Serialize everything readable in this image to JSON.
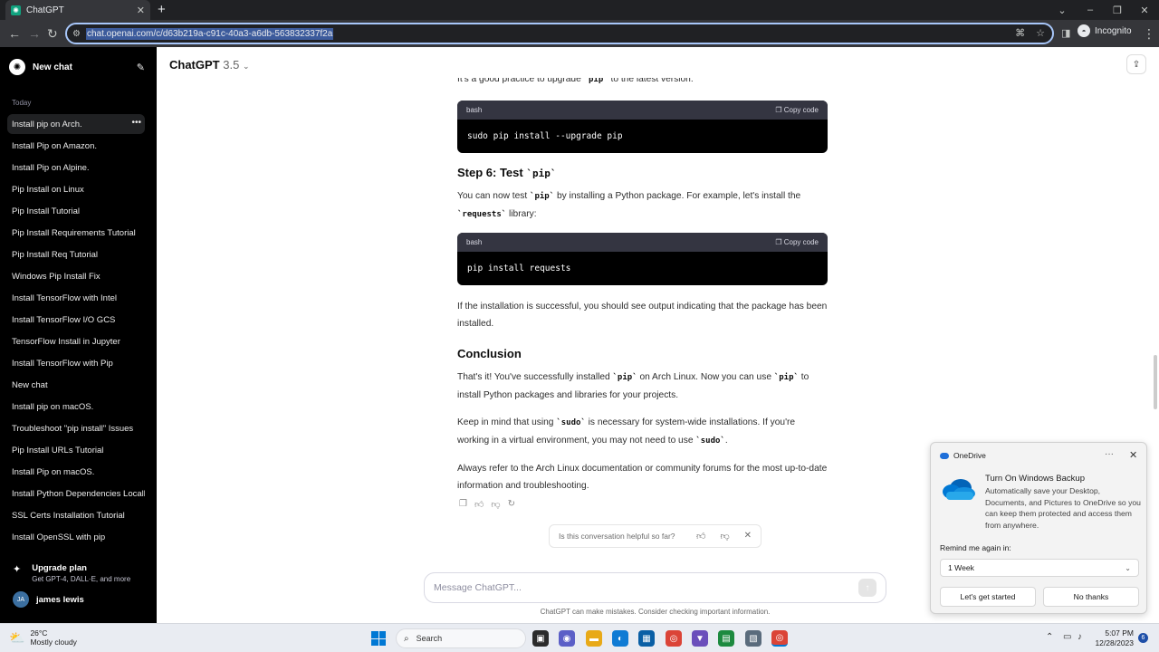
{
  "browser": {
    "tab_title": "ChatGPT",
    "url": "chat.openai.com/c/d63b219a-c91c-40a3-a6db-563832337f2a",
    "profile": "Incognito"
  },
  "sidebar": {
    "new_chat": "New chat",
    "section_today": "Today",
    "conversations": [
      "Install pip on Arch.",
      "Install Pip on Amazon.",
      "Install Pip on Alpine.",
      "Pip Install on Linux",
      "Pip Install Tutorial",
      "Pip Install Requirements Tutorial",
      "Pip Install Req Tutorial",
      "Windows Pip Install Fix",
      "Install TensorFlow with Intel",
      "Install TensorFlow I/O GCS",
      "TensorFlow Install in Jupyter",
      "Install TensorFlow with Pip",
      "New chat",
      "Install pip on macOS.",
      "Troubleshoot \"pip install\" Issues",
      "Pip Install URLs Tutorial",
      "Install Pip on macOS.",
      "Install Python Dependencies Locally",
      "SSL Certs Installation Tutorial",
      "Install OpenSSL with pip"
    ],
    "upgrade_title": "Upgrade plan",
    "upgrade_sub": "Get GPT-4, DALL·E, and more",
    "user_initials": "JA",
    "user_name": "james lewis"
  },
  "header": {
    "model": "ChatGPT",
    "version": "3.5"
  },
  "message": {
    "intro_partial": "It's a good practice to upgrade `pip` to the latest version:",
    "code1_lang": "bash",
    "copy_label": "Copy code",
    "code1": "sudo pip install --upgrade pip",
    "step6_heading": "Step 6: Test `pip`",
    "step6_text": "You can now test `pip` by installing a Python package. For example, let's install the `requests` library:",
    "code2_lang": "bash",
    "code2": "pip install requests",
    "success_text": "If the installation is successful, you should see output indicating that the package has been installed.",
    "conclusion_heading": "Conclusion",
    "conclusion_p1": "That's it! You've successfully installed `pip` on Arch Linux. Now you can use `pip` to install Python packages and libraries for your projects.",
    "conclusion_p2": "Keep in mind that using `sudo` is necessary for system-wide installations. If you're working in a virtual environment, you may not need to use `sudo`.",
    "conclusion_p3": "Always refer to the Arch Linux documentation or community forums for the most up-to-date information and troubleshooting."
  },
  "feedback": {
    "question": "Is this conversation helpful so far?"
  },
  "composer": {
    "placeholder": "Message ChatGPT...",
    "disclaimer": "ChatGPT can make mistakes. Consider checking important information."
  },
  "onedrive": {
    "app": "OneDrive",
    "title": "Turn On Windows Backup",
    "body": "Automatically save your Desktop, Documents, and Pictures to OneDrive so you can keep them protected and access them from anywhere.",
    "remind_label": "Remind me again in:",
    "remind_value": "1 Week",
    "primary_button": "Let's get started",
    "secondary_button": "No thanks"
  },
  "taskbar": {
    "temperature": "26°C",
    "condition": "Mostly cloudy",
    "search": "Search",
    "time": "5:07 PM",
    "date": "12/28/2023",
    "notifications": "6"
  },
  "colors": {
    "sidebar_bg": "#000000",
    "accent": "#10a37f",
    "chrome_dark": "#35363a",
    "onedrive_blue": "#1e6fd9"
  }
}
